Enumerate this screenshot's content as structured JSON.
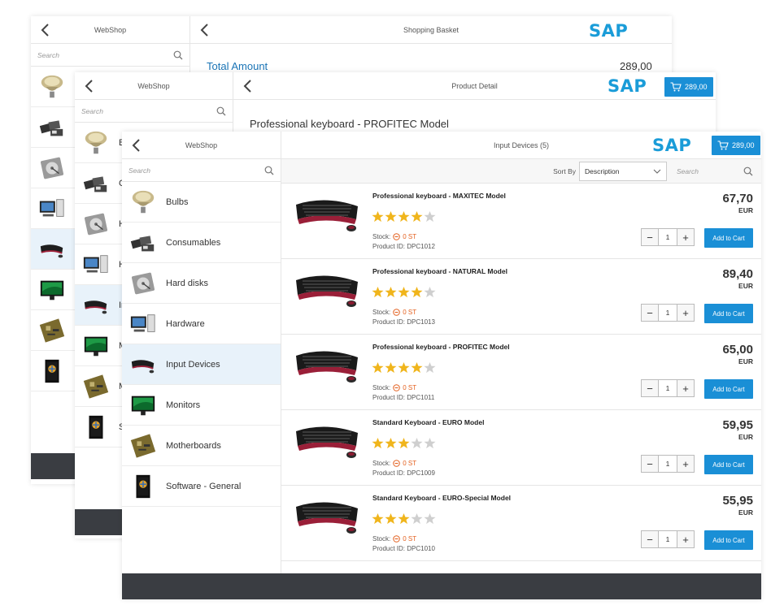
{
  "brand": {
    "logo": "SAP",
    "accent": "#1a8fd6"
  },
  "cart": {
    "amount": "289,00"
  },
  "win1": {
    "left_title": "WebShop",
    "right_title": "Shopping Basket",
    "search_placeholder": "Search",
    "total_label": "Total Amount",
    "total_value": "289,00",
    "cats": [
      "B",
      "C",
      "H",
      "H",
      "In",
      "M",
      "M",
      "S"
    ]
  },
  "win2": {
    "left_title": "WebShop",
    "right_title": "Product Detail",
    "search_placeholder": "Search",
    "product_title": "Professional keyboard - PROFITEC Model",
    "cats": [
      "Bu",
      "Co",
      "Ha",
      "Ha",
      "Inp",
      "Mo",
      "Mo",
      "So"
    ]
  },
  "win3": {
    "left_title": "WebShop",
    "right_title": "Input Devices (5)",
    "search_placeholder": "Search",
    "sort_label": "Sort By",
    "sort_value": "Description",
    "categories": [
      {
        "label": "Bulbs",
        "icon": "bulb-icon"
      },
      {
        "label": "Consumables",
        "icon": "consumables-icon"
      },
      {
        "label": "Hard disks",
        "icon": "harddisk-icon"
      },
      {
        "label": "Hardware",
        "icon": "computer-icon"
      },
      {
        "label": "Input Devices",
        "icon": "keyboard-icon"
      },
      {
        "label": "Monitors",
        "icon": "monitor-icon"
      },
      {
        "label": "Motherboards",
        "icon": "motherboard-icon"
      },
      {
        "label": "Software - General",
        "icon": "software-box-icon"
      }
    ],
    "selected_category": "Input Devices",
    "stock_label": "Stock:",
    "add_label": "Add to Cart",
    "products": [
      {
        "name": "Professional keyboard - MAXITEC Model",
        "rating": 4,
        "stock": "0 ST",
        "pid": "Product ID: DPC1012",
        "price": "67,70",
        "currency": "EUR",
        "qty": "1"
      },
      {
        "name": "Professional keyboard - NATURAL Model",
        "rating": 4,
        "stock": "0 ST",
        "pid": "Product ID: DPC1013",
        "price": "89,40",
        "currency": "EUR",
        "qty": "1"
      },
      {
        "name": "Professional keyboard - PROFITEC Model",
        "rating": 4,
        "stock": "0 ST",
        "pid": "Product ID: DPC1011",
        "price": "65,00",
        "currency": "EUR",
        "qty": "1"
      },
      {
        "name": "Standard Keyboard - EURO Model",
        "rating": 3,
        "stock": "0 ST",
        "pid": "Product ID: DPC1009",
        "price": "59,95",
        "currency": "EUR",
        "qty": "1"
      },
      {
        "name": "Standard Keyboard - EURO-Special Model",
        "rating": 3,
        "stock": "0 ST",
        "pid": "Product ID: DPC1010",
        "price": "55,95",
        "currency": "EUR",
        "qty": "1"
      }
    ]
  }
}
